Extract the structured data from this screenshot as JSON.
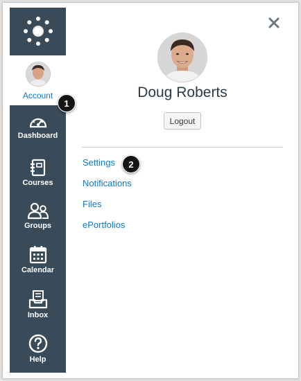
{
  "sidebar": {
    "account_label": "Account",
    "items": [
      {
        "label": "Dashboard",
        "icon": "dashboard-icon"
      },
      {
        "label": "Courses",
        "icon": "courses-icon"
      },
      {
        "label": "Groups",
        "icon": "groups-icon"
      },
      {
        "label": "Calendar",
        "icon": "calendar-icon"
      },
      {
        "label": "Inbox",
        "icon": "inbox-icon"
      },
      {
        "label": "Help",
        "icon": "help-icon"
      }
    ]
  },
  "tray": {
    "user_name": "Doug Roberts",
    "logout_label": "Logout",
    "links": [
      "Settings",
      "Notifications",
      "Files",
      "ePortfolios"
    ]
  },
  "callouts": [
    "1",
    "2"
  ],
  "colors": {
    "sidebar": "#394b58",
    "link": "#0b79c6",
    "text": "#2d3b45",
    "badge": "#141414"
  }
}
